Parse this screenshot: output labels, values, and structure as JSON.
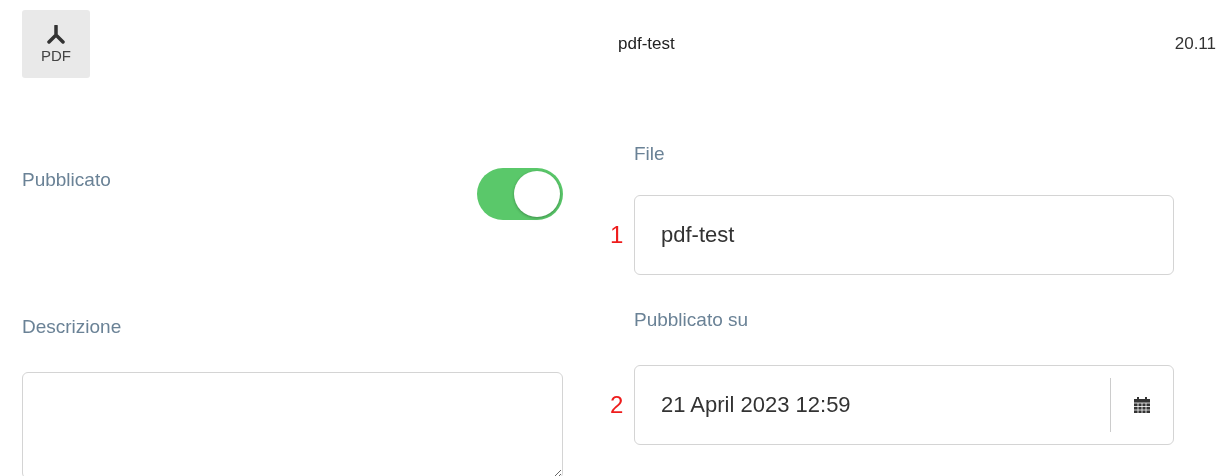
{
  "file_row": {
    "thumbnail": {
      "label": "PDF"
    },
    "name": "pdf-test",
    "date": "20.11"
  },
  "published": {
    "label": "Pubblicato",
    "on": true
  },
  "file_field": {
    "label": "File",
    "value": "pdf-test",
    "marker": "1"
  },
  "description": {
    "label": "Descrizione"
  },
  "published_on": {
    "label": "Pubblicato su",
    "value": "21 April 2023 12:59",
    "marker": "2"
  }
}
